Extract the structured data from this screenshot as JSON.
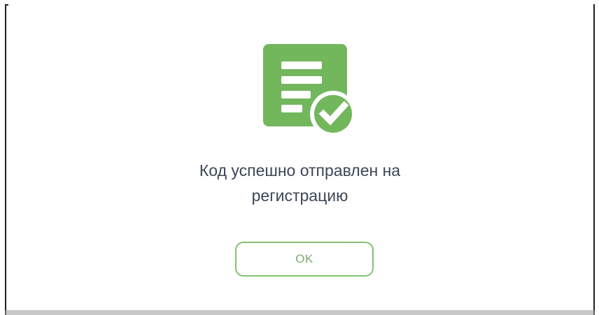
{
  "dialog": {
    "message_line1": "Код успешно отправлен на",
    "message_line2": "регистрацию",
    "ok_label": "OK",
    "icon": "document-check-icon"
  },
  "colors": {
    "accent_green": "#73b75d",
    "button_border": "#84c173",
    "button_text": "#7ea874",
    "text": "#3c4656"
  }
}
